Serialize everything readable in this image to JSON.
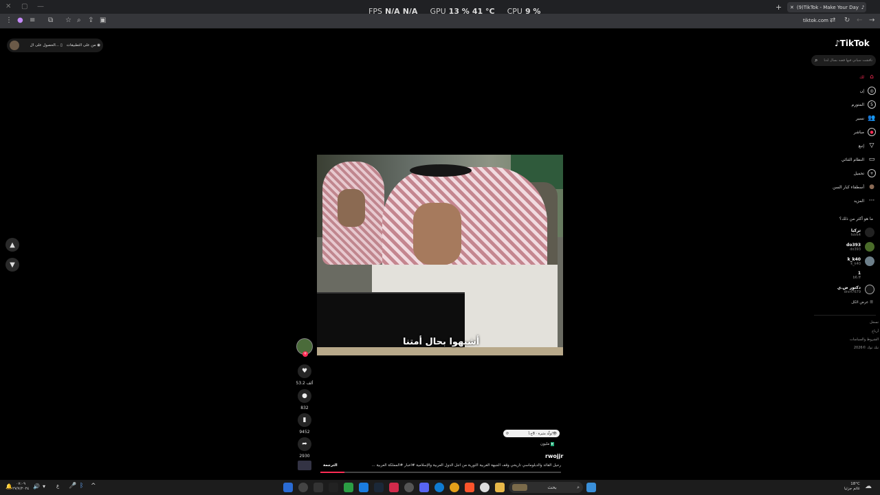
{
  "browser": {
    "tab_title": "(9)TikTok - Make Your Day",
    "url": "tiktok.com",
    "new_tab_icon": "+"
  },
  "perf": {
    "fps_label": "FPS",
    "fps_value": "N/A",
    "fps_value2": "N/A",
    "gpu_label": "GPU",
    "gpu_value": "13 %",
    "gpu_temp": "41 °C",
    "cpu_label": "CPU",
    "cpu_value": "9 %"
  },
  "banner": {
    "item1": "من على التطبيقات",
    "item2": "الحصول على ال..."
  },
  "video": {
    "caption": "أشبهوا بحال أمتنا"
  },
  "actions": {
    "likes": "53.2 ألف",
    "comments": "832",
    "saves": "9452",
    "shares": "2930"
  },
  "post": {
    "sound_text": "ولّد مثيرة · 8ح.آ/👁",
    "views": "مليون",
    "author": "rwojjr",
    "description": "رحيل القائد والدبلوماسي تاريخي وقف الجبهة الغربية الثورية من أجل الدول العربية والإسلامية #أخبار #المملكة العربية ...",
    "translate": "الترجمة",
    "progress": 0.1
  },
  "sidebar": {
    "logo": "TikTok",
    "search_placeholder": "ناقشت سياتي فيها قصه بسال لدنا",
    "nav": [
      {
        "label": "لك",
        "icon": "⌂"
      },
      {
        "label": "إن",
        "icon": "◎"
      },
      {
        "label": "المتورم",
        "icon": "5"
      },
      {
        "label": "نسير",
        "icon": "👥"
      },
      {
        "label": "مباشر",
        "icon": "●"
      },
      {
        "label": "إنبع",
        "icon": "▽"
      },
      {
        "label": "النظام الثنائي",
        "icon": "▭"
      },
      {
        "label": "تحميل",
        "icon": "+"
      },
      {
        "label": "أسطفاء كبار السن",
        "icon": "●"
      },
      {
        "label": "المزيد",
        "icon": "···"
      }
    ],
    "more_heading": "ما هو أكثر من ذلك؟",
    "accounts": [
      {
        "name": "تركيا",
        "handle": "fstrk4"
      },
      {
        "name": "do393",
        "handle": "do393"
      },
      {
        "name": "k_k40",
        "handle": "k_k40"
      },
      {
        "name": "1",
        "handle": "b6.ff"
      },
      {
        "name": "دكتور ض.ي",
        "handle": "drsrf7679"
      }
    ],
    "show_all": "عرض الكل",
    "footer": [
      "تسجل",
      "أرباح",
      "الشروط والسياسات",
      "2026© تيك توك"
    ]
  },
  "taskbar": {
    "search_label": "بحث",
    "time": "٠٧:٠٩",
    "date": "٢٧/٧/٢٠٢٤",
    "lang": "ع",
    "weather_temp": "18°C",
    "weather_text": "غائم جزئيا"
  }
}
